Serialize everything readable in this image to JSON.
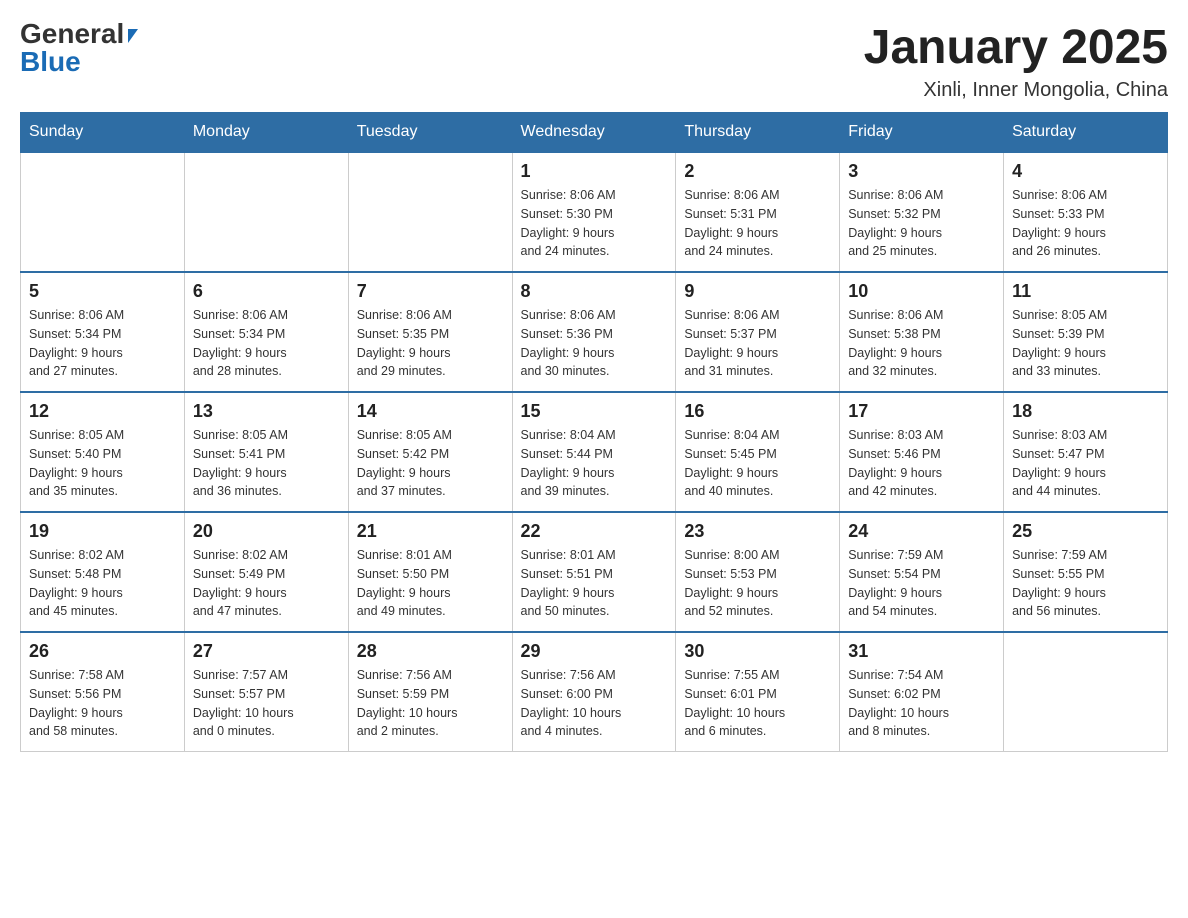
{
  "header": {
    "logo": {
      "general_text": "General",
      "blue_text": "Blue"
    },
    "title": "January 2025",
    "subtitle": "Xinli, Inner Mongolia, China"
  },
  "days_of_week": [
    "Sunday",
    "Monday",
    "Tuesday",
    "Wednesday",
    "Thursday",
    "Friday",
    "Saturday"
  ],
  "weeks": [
    [
      {
        "day": "",
        "info": ""
      },
      {
        "day": "",
        "info": ""
      },
      {
        "day": "",
        "info": ""
      },
      {
        "day": "1",
        "info": "Sunrise: 8:06 AM\nSunset: 5:30 PM\nDaylight: 9 hours\nand 24 minutes."
      },
      {
        "day": "2",
        "info": "Sunrise: 8:06 AM\nSunset: 5:31 PM\nDaylight: 9 hours\nand 24 minutes."
      },
      {
        "day": "3",
        "info": "Sunrise: 8:06 AM\nSunset: 5:32 PM\nDaylight: 9 hours\nand 25 minutes."
      },
      {
        "day": "4",
        "info": "Sunrise: 8:06 AM\nSunset: 5:33 PM\nDaylight: 9 hours\nand 26 minutes."
      }
    ],
    [
      {
        "day": "5",
        "info": "Sunrise: 8:06 AM\nSunset: 5:34 PM\nDaylight: 9 hours\nand 27 minutes."
      },
      {
        "day": "6",
        "info": "Sunrise: 8:06 AM\nSunset: 5:34 PM\nDaylight: 9 hours\nand 28 minutes."
      },
      {
        "day": "7",
        "info": "Sunrise: 8:06 AM\nSunset: 5:35 PM\nDaylight: 9 hours\nand 29 minutes."
      },
      {
        "day": "8",
        "info": "Sunrise: 8:06 AM\nSunset: 5:36 PM\nDaylight: 9 hours\nand 30 minutes."
      },
      {
        "day": "9",
        "info": "Sunrise: 8:06 AM\nSunset: 5:37 PM\nDaylight: 9 hours\nand 31 minutes."
      },
      {
        "day": "10",
        "info": "Sunrise: 8:06 AM\nSunset: 5:38 PM\nDaylight: 9 hours\nand 32 minutes."
      },
      {
        "day": "11",
        "info": "Sunrise: 8:05 AM\nSunset: 5:39 PM\nDaylight: 9 hours\nand 33 minutes."
      }
    ],
    [
      {
        "day": "12",
        "info": "Sunrise: 8:05 AM\nSunset: 5:40 PM\nDaylight: 9 hours\nand 35 minutes."
      },
      {
        "day": "13",
        "info": "Sunrise: 8:05 AM\nSunset: 5:41 PM\nDaylight: 9 hours\nand 36 minutes."
      },
      {
        "day": "14",
        "info": "Sunrise: 8:05 AM\nSunset: 5:42 PM\nDaylight: 9 hours\nand 37 minutes."
      },
      {
        "day": "15",
        "info": "Sunrise: 8:04 AM\nSunset: 5:44 PM\nDaylight: 9 hours\nand 39 minutes."
      },
      {
        "day": "16",
        "info": "Sunrise: 8:04 AM\nSunset: 5:45 PM\nDaylight: 9 hours\nand 40 minutes."
      },
      {
        "day": "17",
        "info": "Sunrise: 8:03 AM\nSunset: 5:46 PM\nDaylight: 9 hours\nand 42 minutes."
      },
      {
        "day": "18",
        "info": "Sunrise: 8:03 AM\nSunset: 5:47 PM\nDaylight: 9 hours\nand 44 minutes."
      }
    ],
    [
      {
        "day": "19",
        "info": "Sunrise: 8:02 AM\nSunset: 5:48 PM\nDaylight: 9 hours\nand 45 minutes."
      },
      {
        "day": "20",
        "info": "Sunrise: 8:02 AM\nSunset: 5:49 PM\nDaylight: 9 hours\nand 47 minutes."
      },
      {
        "day": "21",
        "info": "Sunrise: 8:01 AM\nSunset: 5:50 PM\nDaylight: 9 hours\nand 49 minutes."
      },
      {
        "day": "22",
        "info": "Sunrise: 8:01 AM\nSunset: 5:51 PM\nDaylight: 9 hours\nand 50 minutes."
      },
      {
        "day": "23",
        "info": "Sunrise: 8:00 AM\nSunset: 5:53 PM\nDaylight: 9 hours\nand 52 minutes."
      },
      {
        "day": "24",
        "info": "Sunrise: 7:59 AM\nSunset: 5:54 PM\nDaylight: 9 hours\nand 54 minutes."
      },
      {
        "day": "25",
        "info": "Sunrise: 7:59 AM\nSunset: 5:55 PM\nDaylight: 9 hours\nand 56 minutes."
      }
    ],
    [
      {
        "day": "26",
        "info": "Sunrise: 7:58 AM\nSunset: 5:56 PM\nDaylight: 9 hours\nand 58 minutes."
      },
      {
        "day": "27",
        "info": "Sunrise: 7:57 AM\nSunset: 5:57 PM\nDaylight: 10 hours\nand 0 minutes."
      },
      {
        "day": "28",
        "info": "Sunrise: 7:56 AM\nSunset: 5:59 PM\nDaylight: 10 hours\nand 2 minutes."
      },
      {
        "day": "29",
        "info": "Sunrise: 7:56 AM\nSunset: 6:00 PM\nDaylight: 10 hours\nand 4 minutes."
      },
      {
        "day": "30",
        "info": "Sunrise: 7:55 AM\nSunset: 6:01 PM\nDaylight: 10 hours\nand 6 minutes."
      },
      {
        "day": "31",
        "info": "Sunrise: 7:54 AM\nSunset: 6:02 PM\nDaylight: 10 hours\nand 8 minutes."
      },
      {
        "day": "",
        "info": ""
      }
    ]
  ]
}
